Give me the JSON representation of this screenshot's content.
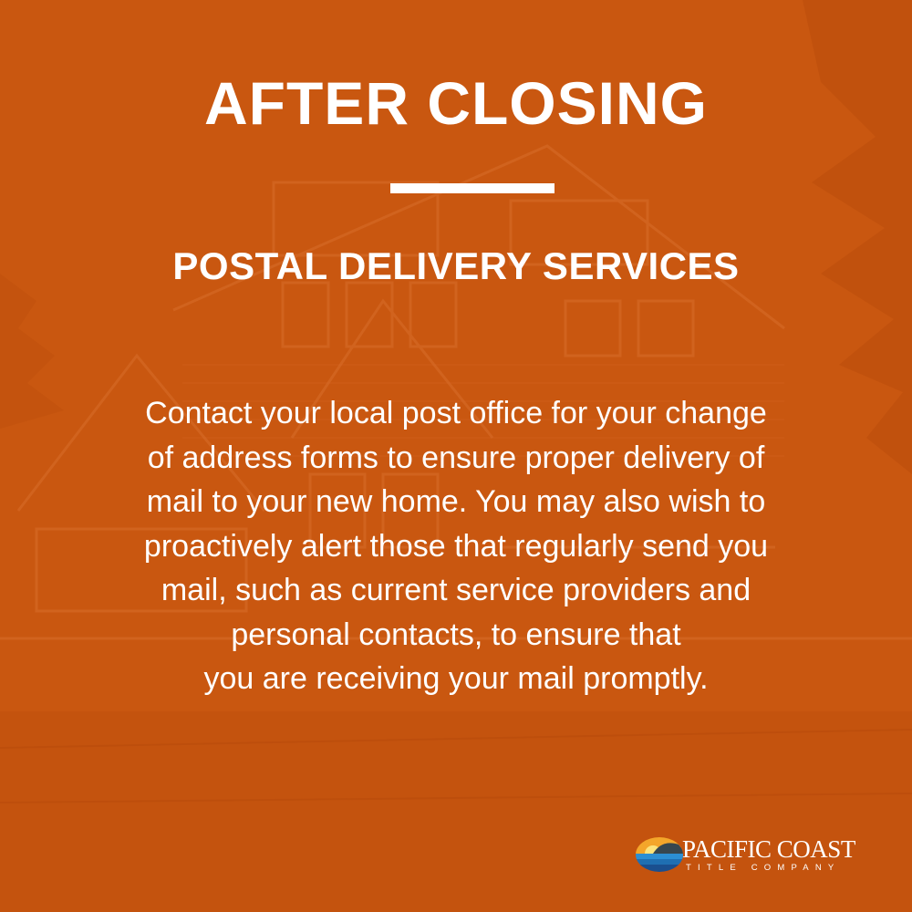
{
  "heading": {
    "title": "AFTER CLOSING",
    "subtitle": "POSTAL DELIVERY SERVICES"
  },
  "body": {
    "paragraph": "Contact your local post office for your change\nof address forms to ensure proper delivery of\nmail to your new home. You may also wish to\nproactively alert those that regularly send you\nmail, such as current service providers and\npersonal contacts, to ensure that\nyou are receiving your mail promptly."
  },
  "logo": {
    "name": "PACIFIC COAST",
    "tagline": "TITLE COMPANY"
  },
  "colors": {
    "background": "#c95710",
    "text": "#ffffff"
  }
}
